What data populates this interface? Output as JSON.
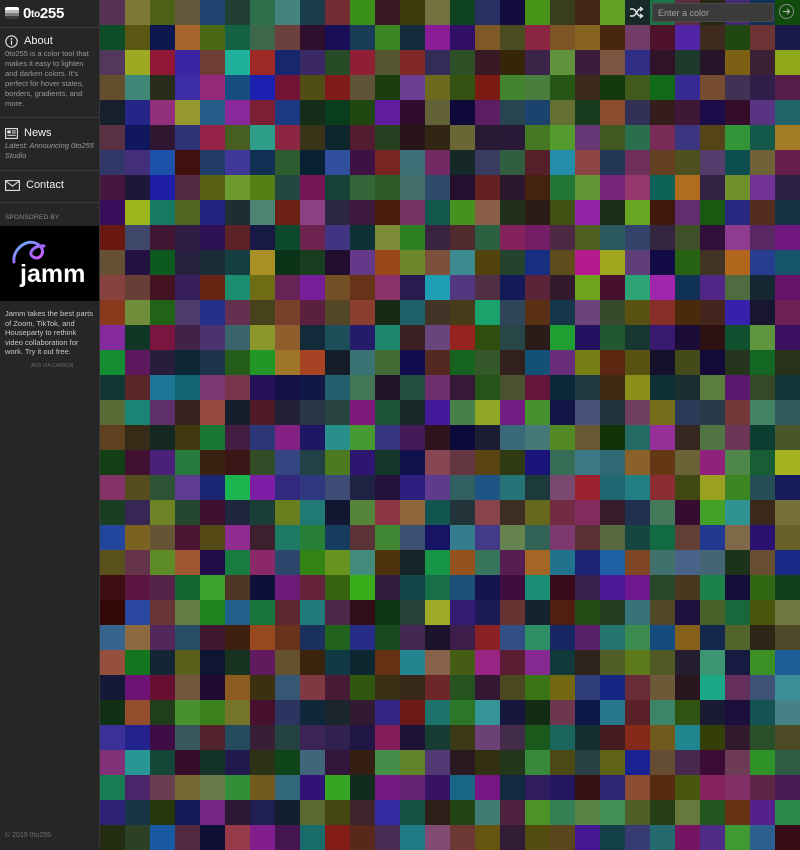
{
  "app": {
    "logo_text": "0",
    "logo_to": "to",
    "logo_num": "255"
  },
  "about": {
    "title": "About",
    "body": "0to255 is a color tool that makes it easy to lighten and darken colors. It's perfect for hover states, borders, gradients, and more."
  },
  "news": {
    "title": "News",
    "body": "Latest: Announcing 0to255 Studio"
  },
  "contact": {
    "title": "Contact"
  },
  "sponsor": {
    "label": "SPONSORED BY",
    "brand": "jamm",
    "text": "Jamm takes the best parts of Zoom, TikTok, and Houseparty to rethink video collaboration for work. Try it out free.",
    "small": "ADS VIA CARBON"
  },
  "footer": {
    "copyright": "© 2019 0to255"
  },
  "toolbar": {
    "search_placeholder": "Enter a color"
  },
  "colors": {
    "sidebar_bg": "#262626",
    "ad_bg": "#000000",
    "jamm_gradient": [
      "#5cc8ff",
      "#9b6bff",
      "#e05cff"
    ]
  },
  "icons": {
    "about": "info-circle-icon",
    "news": "newspaper-icon",
    "contact": "envelope-icon",
    "shuffle": "shuffle-icon",
    "go": "arrow-right-circle-icon"
  },
  "grid": {
    "columns": 28,
    "rows": 34
  }
}
